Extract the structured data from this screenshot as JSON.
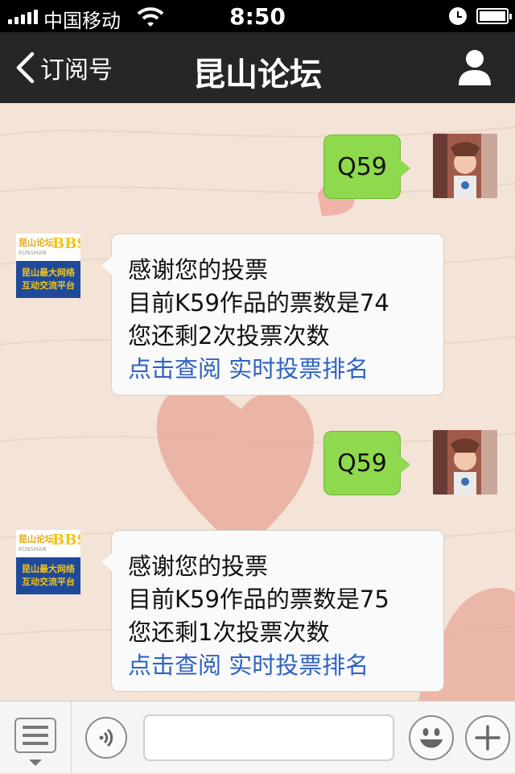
{
  "status_bar": {
    "carrier": "中国移动",
    "time": "8:50",
    "icons": [
      "signal-icon",
      "wifi-icon",
      "alarm-icon",
      "battery-icon"
    ]
  },
  "nav": {
    "back_label": "订阅号",
    "title": "昆山论坛",
    "icons": [
      "back-chevron-icon",
      "profile-icon"
    ]
  },
  "brand": {
    "name": "昆山论坛",
    "tag": "BBS",
    "sub": "KUNSHAN",
    "slogan_1": "昆山最大网络",
    "slogan_2": "互动交流平台"
  },
  "messages": [
    {
      "from": "me",
      "text": "Q59"
    },
    {
      "from": "other",
      "lines": [
        "感谢您的投票",
        "目前K59作品的票数是74",
        "您还剩2次投票次数"
      ],
      "links": [
        "点击查阅",
        "实时投票排名"
      ]
    },
    {
      "from": "me",
      "text": "Q59"
    },
    {
      "from": "other",
      "lines": [
        "感谢您的投票",
        "目前K59作品的票数是75",
        "您还剩1次投票次数"
      ],
      "links": [
        "点击查阅",
        "实时投票排名"
      ]
    }
  ],
  "toolbar": {
    "icons": [
      "menu-icon",
      "voice-icon",
      "emoji-icon",
      "plus-icon"
    ],
    "input_value": ""
  },
  "colors": {
    "nav_bg": "#242627",
    "chat_bg": "#f4e3d7",
    "my_bubble": "#8ed94e",
    "link": "#2e63c4",
    "brand_yellow": "#f2c418",
    "brand_blue": "#1f4a9a"
  }
}
